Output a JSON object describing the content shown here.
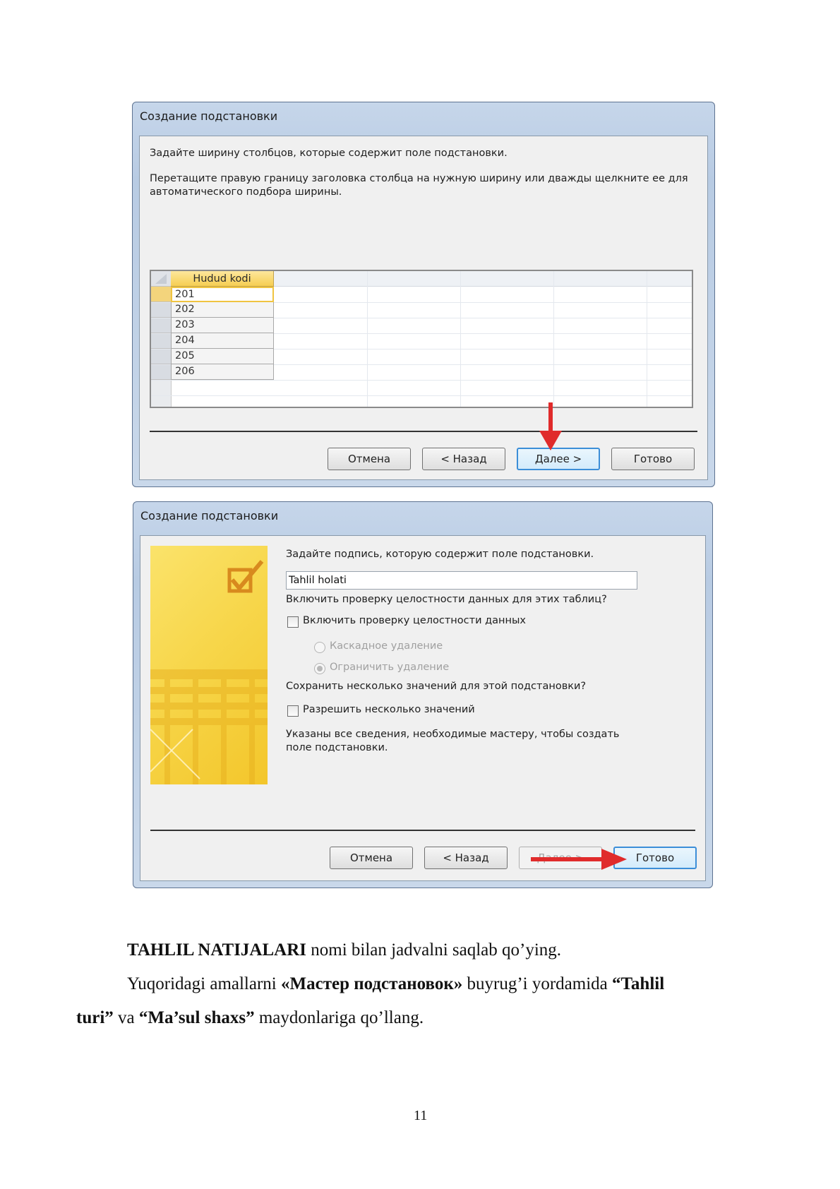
{
  "dialog1": {
    "title": "Создание подстановки",
    "instruction1": "Задайте ширину столбцов, которые содержит поле подстановки.",
    "instruction2_line1": "Перетащите правую границу заголовка столбца на нужную ширину или дважды щелкните ее для",
    "instruction2_line2": "автоматического подбора ширины.",
    "grid": {
      "header": "Hudud kodi",
      "rows": [
        "201",
        "202",
        "203",
        "204",
        "205",
        "206"
      ]
    },
    "buttons": {
      "cancel": "Отмена",
      "back": "< Назад",
      "next": "Далее >",
      "finish": "Готово"
    }
  },
  "dialog2": {
    "title": "Создание подстановки",
    "label_prompt": "Задайте подпись, которую содержит поле подстановки.",
    "label_value": "Tahlil holati",
    "integrity_question": "Включить проверку целостности данных для этих таблиц?",
    "integrity_checkbox": "Включить проверку целостности данных",
    "cascade_delete": "Каскадное удаление",
    "restrict_delete": "Ограничить удаление",
    "multi_question": "Сохранить несколько значений для этой подстановки?",
    "multi_checkbox": "Разрешить несколько значений",
    "done_line1": "Указаны все сведения, необходимые мастеру, чтобы создать",
    "done_line2": "поле подстановки.",
    "buttons": {
      "cancel": "Отмена",
      "back": "< Назад",
      "next": "Далее >",
      "finish": "Готово"
    }
  },
  "text": {
    "p1_bold": "TAHLIL NATIJALARI",
    "p1_rest": " nomi bilan jadvalni saqlab qo’ying.",
    "p2_a": "Yuqoridagi amallarni ",
    "p2_b": "«Мастер подстановок»",
    "p2_c": " buyrug’i yordamida ",
    "p2_d": "“Tahlil",
    "p3_a": "turi”",
    "p3_b": " va ",
    "p3_c": "“Ma’sul shaxs”",
    "p3_d": " maydonlariga qo’llang."
  },
  "page_number": "11",
  "colors": {
    "arrow": "#e02b2b",
    "header_gold": "#f6ce52",
    "focus_blue": "#3c8ed8"
  }
}
